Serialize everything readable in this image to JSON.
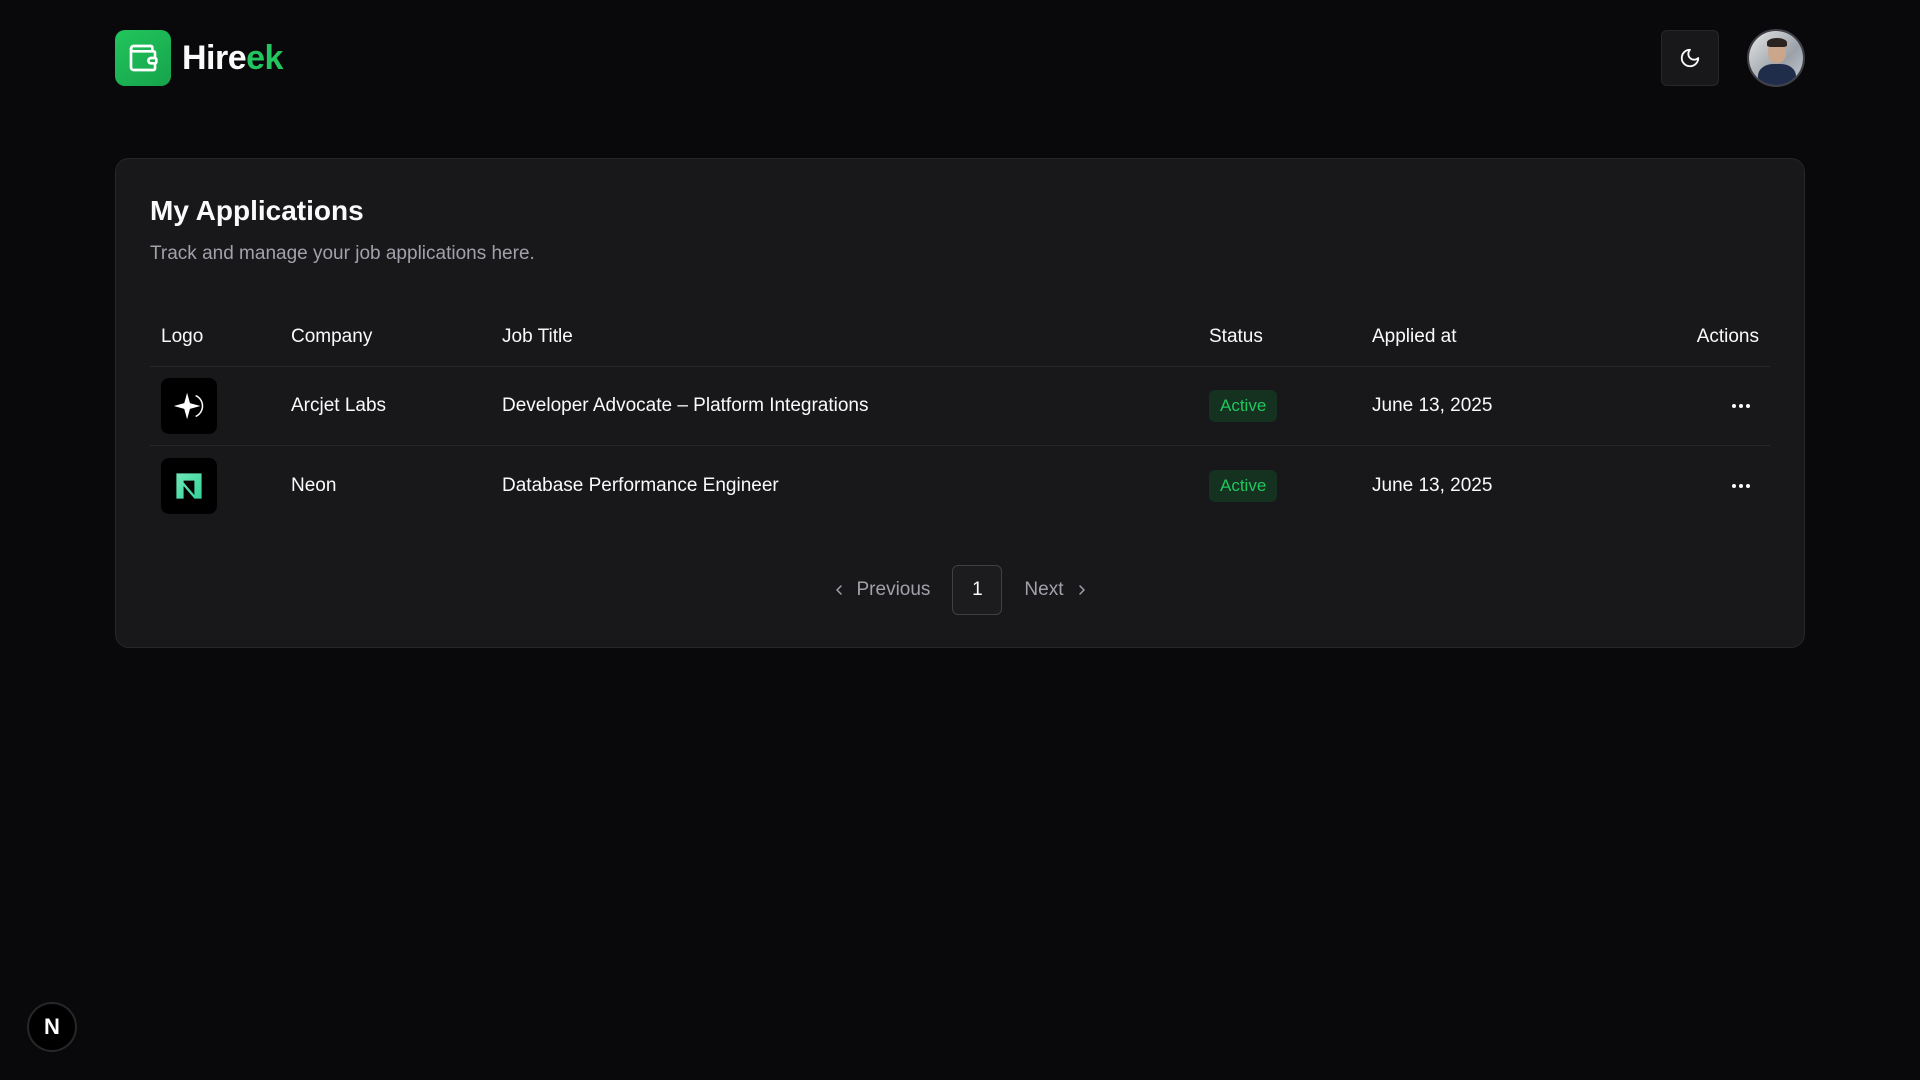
{
  "brand": {
    "name_main": "Hire",
    "name_accent": "ek",
    "accent_color": "#22c55e",
    "logo_icon": "wallet-icon"
  },
  "header": {
    "theme_toggle_icon": "moon-icon",
    "avatar": "user-avatar"
  },
  "card": {
    "title": "My Applications",
    "subtitle": "Track and manage your job applications here."
  },
  "table": {
    "columns": [
      "Logo",
      "Company",
      "Job Title",
      "Status",
      "Applied at",
      "Actions"
    ],
    "rows": [
      {
        "logo_icon": "arcjet-logo-icon",
        "company": "Arcjet Labs",
        "job_title": "Developer Advocate – Platform Integrations",
        "status": "Active",
        "applied_at": "June 13, 2025",
        "actions_icon": "more-horizontal-icon"
      },
      {
        "logo_icon": "neon-logo-icon",
        "company": "Neon",
        "job_title": "Database Performance Engineer",
        "status": "Active",
        "applied_at": "June 13, 2025",
        "actions_icon": "more-horizontal-icon"
      }
    ]
  },
  "pagination": {
    "previous_label": "Previous",
    "current_page": "1",
    "next_label": "Next"
  },
  "dev_indicator": {
    "label": "N"
  }
}
